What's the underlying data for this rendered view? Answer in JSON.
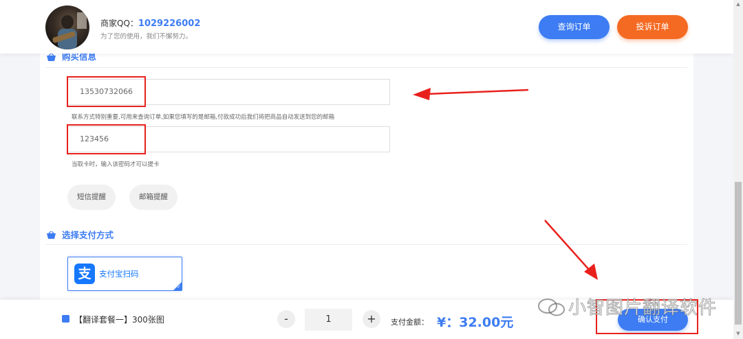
{
  "header": {
    "merchant_label": "商家QQ：",
    "merchant_qq": "1029226002",
    "motto": "为了您的使用，我们不懈努力。",
    "query_button": "查询订单",
    "complain_button": "投诉订单"
  },
  "purchase": {
    "section_title": "购买信息",
    "contact_value": "13530732066",
    "contact_hint": "联系方式特别重要,可用来查询订单,如果您填写的是邮箱,付款成功后我们将把商品自动发送到您的邮箱",
    "password_value": "123456",
    "password_hint": "当取卡时，输入该密码才可以提卡",
    "sms_reminder": "短信提醒",
    "email_reminder": "邮箱提醒"
  },
  "payment": {
    "section_title": "选择支付方式",
    "alipay_logo": "支",
    "alipay_label": "支付宝扫码"
  },
  "bottom": {
    "product_name": "【翻译套餐一】300张图",
    "minus": "-",
    "quantity": "1",
    "plus": "+",
    "amount_label": "支付金额：",
    "amount_value": "¥：32.00元",
    "confirm_button": "确认支付"
  },
  "watermark": {
    "text": "小智图片翻译软件"
  },
  "colors": {
    "primary": "#3d7cf2",
    "accent_orange": "#f56a23",
    "annotation_red": "#e8201c"
  },
  "icons": {
    "basket": "basket-icon",
    "alipay": "alipay-logo-icon",
    "product": "product-icon",
    "wechat": "wechat-icon"
  }
}
